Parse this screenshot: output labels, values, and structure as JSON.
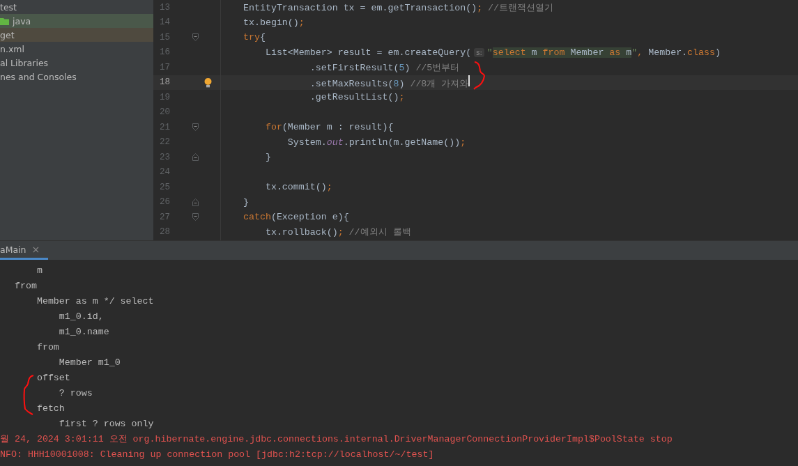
{
  "project_tree": {
    "items": [
      {
        "label": "test",
        "kind": "text"
      },
      {
        "label": "java",
        "kind": "folder",
        "color": "#4a584a"
      },
      {
        "label": "get",
        "kind": "text",
        "color": "#4f4a3f"
      },
      {
        "label": "n.xml",
        "kind": "text"
      },
      {
        "label": "al Libraries",
        "kind": "text"
      },
      {
        "label": "nes and Consoles",
        "kind": "text"
      }
    ]
  },
  "editor": {
    "lines": [
      {
        "number": "13",
        "current": false,
        "bulb": false,
        "tokens": [
          {
            "t": "EntityTransaction tx = em.getTransaction()",
            "kind": "plain"
          },
          {
            "t": ";",
            "kind": "punct"
          },
          {
            "t": " //트랜잭션열기",
            "kind": "comment"
          }
        ]
      },
      {
        "number": "14",
        "current": false,
        "bulb": false,
        "tokens": [
          {
            "t": "tx.begin()",
            "kind": "plain"
          },
          {
            "t": ";",
            "kind": "punct"
          }
        ]
      },
      {
        "number": "15",
        "current": false,
        "bulb": false,
        "kind": "fold_start",
        "tokens": [
          {
            "t": "try",
            "kind": "kw"
          },
          {
            "t": "{",
            "kind": "plain"
          }
        ]
      },
      {
        "number": "16",
        "current": false,
        "bulb": false,
        "tokens": [
          {
            "t": "    List<Member> result = em.createQuery(",
            "kind": "plain"
          },
          {
            "t": "s:",
            "kind": "hint"
          },
          {
            "t": "\"",
            "kind": "str"
          },
          {
            "t": "select",
            "kind": "sqlkw"
          },
          {
            "t": " m ",
            "kind": "sql"
          },
          {
            "t": "from",
            "kind": "sqlkw"
          },
          {
            "t": " Member ",
            "kind": "sql"
          },
          {
            "t": "as",
            "kind": "sqlkw"
          },
          {
            "t": " m",
            "kind": "sql"
          },
          {
            "t": "\"",
            "kind": "str"
          },
          {
            "t": ",",
            "kind": "punct"
          },
          {
            "t": " Member.",
            "kind": "plain"
          },
          {
            "t": "class",
            "kind": "kw"
          },
          {
            "t": ")",
            "kind": "plain"
          }
        ]
      },
      {
        "number": "17",
        "current": false,
        "bulb": false,
        "tokens": [
          {
            "t": "            .setFirstResult(",
            "kind": "plain"
          },
          {
            "t": "5",
            "kind": "num"
          },
          {
            "t": ") ",
            "kind": "plain"
          },
          {
            "t": "//5번부터",
            "kind": "comment"
          }
        ]
      },
      {
        "number": "18",
        "current": true,
        "bulb": true,
        "tokens": [
          {
            "t": "            .setMaxResults(",
            "kind": "plain"
          },
          {
            "t": "8",
            "kind": "num"
          },
          {
            "t": ") ",
            "kind": "plain"
          },
          {
            "t": "//8개 가져와",
            "kind": "comment"
          }
        ]
      },
      {
        "number": "19",
        "current": false,
        "bulb": false,
        "tokens": [
          {
            "t": "            .getResultList()",
            "kind": "plain"
          },
          {
            "t": ";",
            "kind": "punct"
          }
        ]
      },
      {
        "number": "20",
        "current": false,
        "bulb": false
      },
      {
        "number": "21",
        "current": false,
        "bulb": false,
        "kind": "fold_start",
        "tokens": [
          {
            "t": "    for",
            "kind": "kw"
          },
          {
            "t": "(Member m : result){",
            "kind": "plain"
          }
        ]
      },
      {
        "number": "22",
        "current": false,
        "bulb": false,
        "tokens": [
          {
            "t": "        System.",
            "kind": "plain"
          },
          {
            "t": "out",
            "kind": "field"
          },
          {
            "t": ".println(m.getName())",
            "kind": "plain"
          },
          {
            "t": ";",
            "kind": "punct"
          }
        ]
      },
      {
        "number": "23",
        "current": false,
        "bulb": false,
        "kind": "fold_end",
        "tokens": [
          {
            "t": "    }",
            "kind": "plain"
          }
        ]
      },
      {
        "number": "24",
        "current": false,
        "bulb": false
      },
      {
        "number": "25",
        "current": false,
        "bulb": false,
        "tokens": [
          {
            "t": "    tx.commit()",
            "kind": "plain"
          },
          {
            "t": ";",
            "kind": "punct"
          }
        ]
      },
      {
        "number": "26",
        "current": false,
        "bulb": false,
        "kind": "fold_end",
        "tokens": [
          {
            "t": "}",
            "kind": "plain"
          }
        ]
      },
      {
        "number": "27",
        "current": false,
        "bulb": false,
        "kind": "fold_start",
        "tokens": [
          {
            "t": "catch",
            "kind": "kw"
          },
          {
            "t": "(Exception e){",
            "kind": "plain"
          }
        ]
      },
      {
        "number": "28",
        "current": false,
        "bulb": false,
        "tokens": [
          {
            "t": "    tx.rollback()",
            "kind": "plain"
          },
          {
            "t": ";",
            "kind": "punct"
          },
          {
            "t": " //예외시 롤백",
            "kind": "comment"
          }
        ]
      }
    ]
  },
  "console": {
    "tab": {
      "label": "aMain",
      "close": "×"
    },
    "lines": [
      {
        "text": "    m",
        "kind": "out"
      },
      {
        "text": "from",
        "kind": "out"
      },
      {
        "text": "    Member as m */ select",
        "kind": "out"
      },
      {
        "text": "        m1_0.id,",
        "kind": "out"
      },
      {
        "text": "        m1_0.name",
        "kind": "out"
      },
      {
        "text": "    from",
        "kind": "out"
      },
      {
        "text": "        Member m1_0",
        "kind": "out"
      },
      {
        "text": "    offset",
        "kind": "out"
      },
      {
        "text": "        ? rows",
        "kind": "out"
      },
      {
        "text": "    fetch",
        "kind": "out"
      },
      {
        "text": "        first ? rows only",
        "kind": "out"
      },
      {
        "text": "월 24, 2024 3:01:11 오전 org.hibernate.engine.jdbc.connections.internal.DriverManagerConnectionProviderImpl$PoolState stop",
        "kind": "err"
      },
      {
        "text": "NFO: HHH10001008: Cleaning up connection pool [jdbc:h2:tcp://localhost/~/test]",
        "kind": "err"
      }
    ]
  }
}
